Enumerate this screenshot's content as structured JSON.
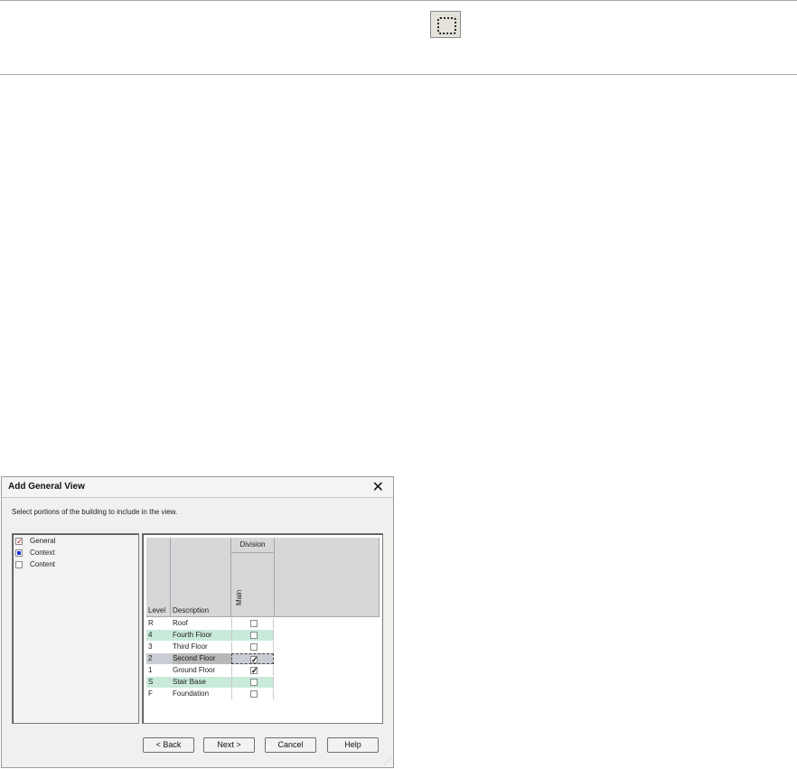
{
  "toolbar": {
    "icon": "dotted-selection-icon"
  },
  "dialog": {
    "title": "Add General View",
    "close_glyph": "✕",
    "instruction": "Select portions of the building to include in the view.",
    "tree": [
      {
        "label": "General",
        "state": "checked"
      },
      {
        "label": "Context",
        "state": "partial"
      },
      {
        "label": "Content",
        "state": "unchecked"
      }
    ],
    "grid": {
      "col_level": "Level",
      "col_description": "Description",
      "group_header": "Division",
      "col_division": "Main",
      "rows": [
        {
          "level": "R",
          "description": "Roof",
          "main": false
        },
        {
          "level": "4",
          "description": "Fourth Floor",
          "main": false
        },
        {
          "level": "3",
          "description": "Third Floor",
          "main": false
        },
        {
          "level": "2",
          "description": "Second Floor",
          "main": true
        },
        {
          "level": "1",
          "description": "Ground Floor",
          "main": true
        },
        {
          "level": "S",
          "description": "Stair Base",
          "main": false
        },
        {
          "level": "F",
          "description": "Foundation",
          "main": false
        }
      ]
    },
    "buttons": {
      "back": "< Back",
      "next": "Next >",
      "cancel": "Cancel",
      "help": "Help"
    }
  }
}
